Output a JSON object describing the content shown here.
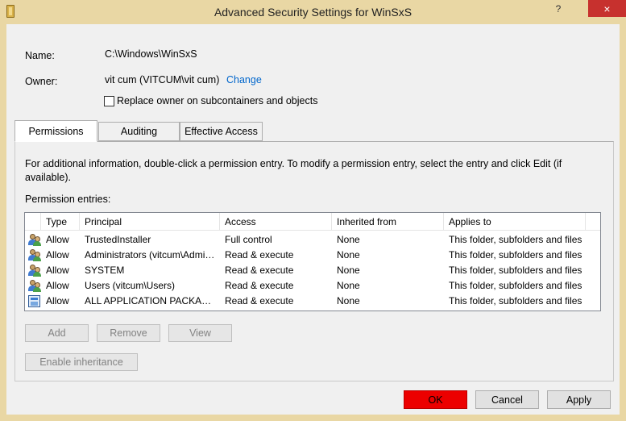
{
  "window": {
    "title": "Advanced Security Settings for WinSxS",
    "help_glyph": "?",
    "close_glyph": "×"
  },
  "object": {
    "name_label": "Name:",
    "name_value": "C:\\Windows\\WinSxS",
    "owner_label": "Owner:",
    "owner_value": "vit cum (VITCUM\\vit cum)",
    "change_link": "Change",
    "replace_owner_label": "Replace owner on subcontainers and objects",
    "replace_owner_checked": false
  },
  "tabs": [
    {
      "label": "Permissions",
      "active": true
    },
    {
      "label": "Auditing",
      "active": false
    },
    {
      "label": "Effective Access",
      "active": false
    }
  ],
  "permissions": {
    "info_text": "For additional information, double-click a permission entry. To modify a permission entry, select the entry and click Edit (if available).",
    "entries_label": "Permission entries:",
    "columns": [
      "Type",
      "Principal",
      "Access",
      "Inherited from",
      "Applies to"
    ],
    "rows": [
      {
        "icon": "users-icon",
        "type": "Allow",
        "principal": "TrustedInstaller",
        "access": "Full control",
        "inherited": "None",
        "applies": "This folder, subfolders and files"
      },
      {
        "icon": "users-icon",
        "type": "Allow",
        "principal": "Administrators (vitcum\\Administrators)",
        "access": "Read & execute",
        "inherited": "None",
        "applies": "This folder, subfolders and files"
      },
      {
        "icon": "users-icon",
        "type": "Allow",
        "principal": "SYSTEM",
        "access": "Read & execute",
        "inherited": "None",
        "applies": "This folder, subfolders and files"
      },
      {
        "icon": "users-icon",
        "type": "Allow",
        "principal": "Users (vitcum\\Users)",
        "access": "Read & execute",
        "inherited": "None",
        "applies": "This folder, subfolders and files"
      },
      {
        "icon": "package-icon",
        "type": "Allow",
        "principal": "ALL APPLICATION PACKAGES",
        "access": "Read & execute",
        "inherited": "None",
        "applies": "This folder, subfolders and files"
      }
    ],
    "buttons": {
      "add": "Add",
      "remove": "Remove",
      "view": "View",
      "enable_inheritance": "Enable inheritance"
    }
  },
  "footer": {
    "ok": "OK",
    "cancel": "Cancel",
    "apply": "Apply"
  },
  "colors": {
    "titlebar": "#e9d7a4",
    "close_button": "#c7312e",
    "ok_button": "#ec0000",
    "link": "#0066cc"
  }
}
